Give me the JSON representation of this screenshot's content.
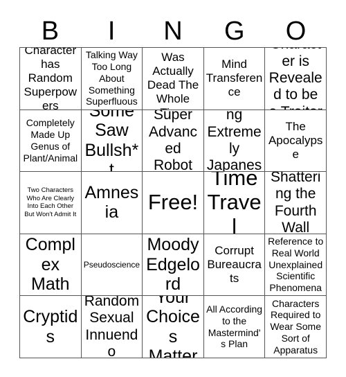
{
  "card": {
    "title": "BINGO",
    "free_space_index": 12
  },
  "header": {
    "letters": [
      "B",
      "I",
      "N",
      "G",
      "O"
    ]
  },
  "grid": {
    "columns": 5,
    "rows": 5,
    "border_color": "#555555",
    "cell_background": "#ffffff",
    "text_color": "#000000",
    "cells": [
      {
        "text": "Character has Random Superpowers",
        "size": "md"
      },
      {
        "text": "Talking Way Too Long About Something Superfluous",
        "size": "sm"
      },
      {
        "text": "Character Was Actually Dead The Whole Time",
        "size": "md"
      },
      {
        "text": "Mind Transference",
        "size": "md"
      },
      {
        "text": "Character is Revealed to be a Traitor",
        "size": "lg"
      },
      {
        "text": "Completely Made Up Genus of Plant/Animal",
        "size": "sm"
      },
      {
        "text": "Some Saw Bullsh*t",
        "size": "xl"
      },
      {
        "text": "Super Advanced Robot",
        "size": "lg"
      },
      {
        "text": "Something Extremely Japanese",
        "size": "lg"
      },
      {
        "text": "The Apocalypse",
        "size": "md"
      },
      {
        "text": "Two Characters Who Are Clearly Into Each Other But Won't Admit It",
        "size": "xxs"
      },
      {
        "text": "Amnesia",
        "size": "xl"
      },
      {
        "text": "Free!",
        "size": "xxl"
      },
      {
        "text": "Time Travel",
        "size": "xxl"
      },
      {
        "text": "Shattering the Fourth Wall",
        "size": "lg"
      },
      {
        "text": "Complex Math",
        "size": "xl"
      },
      {
        "text": "Pseudoscience",
        "size": "xs"
      },
      {
        "text": "Moody Edgelord",
        "size": "xl"
      },
      {
        "text": "Corrupt Bureaucrats",
        "size": "md"
      },
      {
        "text": "Reference to Real World Unexplained Scientific Phenomena",
        "size": "sm"
      },
      {
        "text": "Cryptids",
        "size": "xl"
      },
      {
        "text": "Random Sexual Innuendo",
        "size": "lg"
      },
      {
        "text": "Your Choices Matter",
        "size": "xl"
      },
      {
        "text": "All According to the Mastermind's Plan",
        "size": "sm"
      },
      {
        "text": "Characters Required to Wear Some Sort of Apparatus",
        "size": "sm"
      }
    ]
  }
}
